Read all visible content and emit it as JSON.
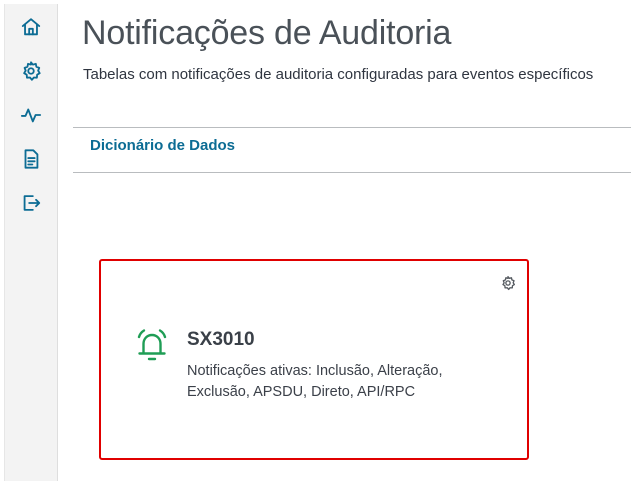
{
  "sidebar": {
    "items": [
      {
        "icon": "home-icon"
      },
      {
        "icon": "gear-icon"
      },
      {
        "icon": "activity-icon"
      },
      {
        "icon": "document-icon"
      },
      {
        "icon": "logout-icon"
      }
    ]
  },
  "header": {
    "title": "Notificações de Auditoria",
    "subtitle": "Tabelas com notificações de auditoria configuradas para eventos específicos"
  },
  "tabs": {
    "active_label": "Dicionário de Dados"
  },
  "card": {
    "title": "SX3010",
    "description": "Notificações ativas: Inclusão, Alteração, Exclusão, APSDU, Direto, API/RPC",
    "icon": "bell-icon",
    "settings_icon": "gear-icon",
    "border_color": "#e00000",
    "icon_color": "#1f9d55"
  },
  "colors": {
    "accent": "#0c6c94",
    "icon": "#0c6c94"
  }
}
